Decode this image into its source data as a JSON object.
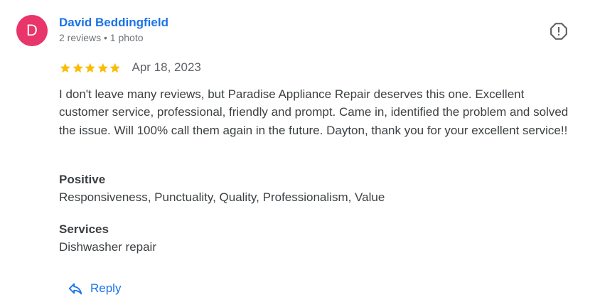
{
  "author": {
    "initial": "D",
    "name": "David Beddingfield",
    "meta": "2 reviews • 1 photo",
    "avatar_color": "#e8356a"
  },
  "rating": {
    "stars": 5,
    "max": 5,
    "date": "Apr 18, 2023",
    "star_color": "#fbbc04"
  },
  "review_text": "I don't leave many reviews, but Paradise Appliance Repair deserves this one. Excellent customer service, professional, friendly and prompt. Came in, identified the problem and solved the issue. Will 100% call them again in the future. Dayton, thank you for your excellent service!!",
  "sections": {
    "positive": {
      "title": "Positive",
      "value": "Responsiveness, Punctuality, Quality, Professionalism, Value"
    },
    "services": {
      "title": "Services",
      "value": "Dishwasher repair"
    }
  },
  "actions": {
    "reply_label": "Reply",
    "report_icon": "report-icon"
  },
  "colors": {
    "link": "#1a73e8",
    "text": "#3c4043",
    "muted": "#70757a"
  }
}
